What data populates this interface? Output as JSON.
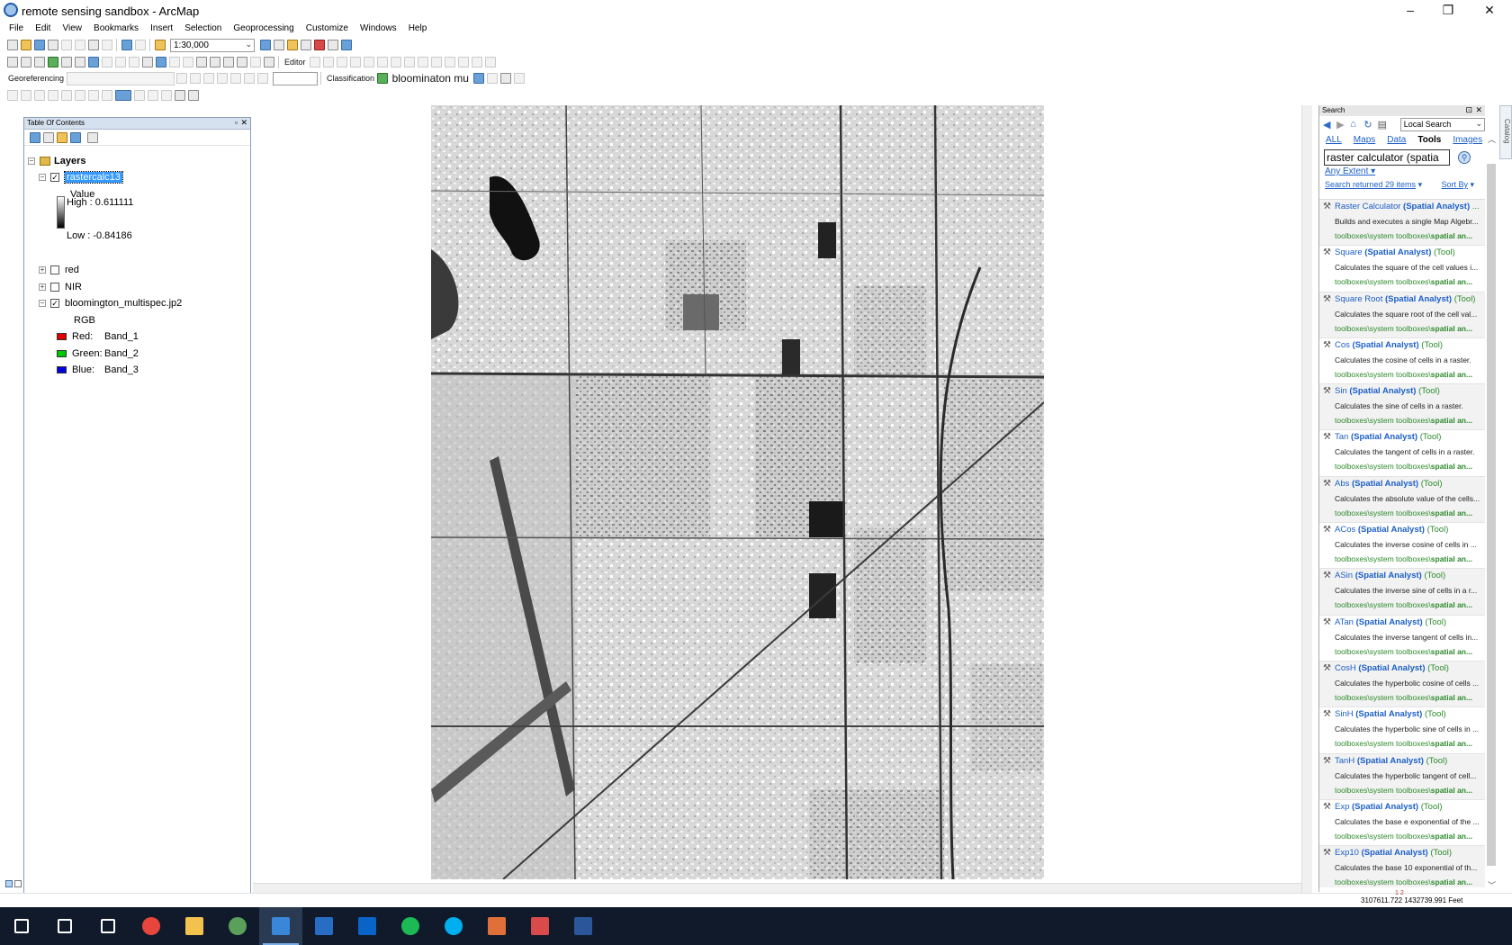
{
  "window": {
    "title": "remote sensing sandbox - ArcMap",
    "minimize_glyph": "–",
    "restore_glyph": "❐",
    "close_glyph": "✕"
  },
  "menu": [
    "File",
    "Edit",
    "View",
    "Bookmarks",
    "Insert",
    "Selection",
    "Geoprocessing",
    "Customize",
    "Windows",
    "Help"
  ],
  "toolbars": {
    "scale_value": "1:30,000",
    "editor_label": "Editor",
    "georeferencing_label": "Georeferencing",
    "classification_label": "Classification",
    "layer_combo_value": "bloominaton mu"
  },
  "toc": {
    "panel_title": "Table Of Contents",
    "root_label": "Layers",
    "layers": [
      {
        "name": "rastercalc13",
        "checked": true,
        "expanded": true,
        "selected": true
      },
      {
        "name": "red",
        "checked": false,
        "expanded": false
      },
      {
        "name": "NIR",
        "checked": false,
        "expanded": false
      },
      {
        "name": "bloomington_multispec.jp2",
        "checked": true,
        "expanded": true
      }
    ],
    "rastercalc_legend": {
      "field": "Value",
      "high": "High : 0.611111",
      "low": "Low : -0.84186"
    },
    "rgb_legend": {
      "title": "RGB",
      "bands": [
        {
          "channel": "Red:",
          "band": "Band_1",
          "color": "#e00000"
        },
        {
          "channel": "Green:",
          "band": "Band_2",
          "color": "#00c800"
        },
        {
          "channel": "Blue:",
          "band": "Band_3",
          "color": "#0000e0"
        }
      ]
    }
  },
  "search": {
    "panel_title": "Search",
    "scope": "Local Search",
    "categories": [
      "ALL",
      "Maps",
      "Data",
      "Tools",
      "Images"
    ],
    "active_category": "Tools",
    "query": "raster calculator (spatia",
    "extent": "Any Extent",
    "result_count": "Search returned 29 items",
    "sort_label": "Sort By",
    "results": [
      {
        "name": "Raster Calculator",
        "toolset": "(Spatial Analyst)",
        "type": "...",
        "desc": "Builds and executes a single Map Algebr...",
        "path": "toolboxes\\system toolboxes\\",
        "path_bold": "spatial an..."
      },
      {
        "name": "Square",
        "toolset": "(Spatial Analyst)",
        "type": "(Tool)",
        "desc": "Calculates the square of the cell values i...",
        "path": "toolboxes\\system toolboxes\\",
        "path_bold": "spatial an..."
      },
      {
        "name": "Square Root",
        "toolset": "(Spatial Analyst)",
        "type": "(Tool)",
        "desc": "Calculates the square root of the cell val...",
        "path": "toolboxes\\system toolboxes\\",
        "path_bold": "spatial an..."
      },
      {
        "name": "Cos",
        "toolset": "(Spatial Analyst)",
        "type": "(Tool)",
        "desc": "Calculates the cosine of cells in a raster.",
        "path": "toolboxes\\system toolboxes\\",
        "path_bold": "spatial an..."
      },
      {
        "name": "Sin",
        "toolset": "(Spatial Analyst)",
        "type": "(Tool)",
        "desc": "Calculates the sine of cells in a raster.",
        "path": "toolboxes\\system toolboxes\\",
        "path_bold": "spatial an..."
      },
      {
        "name": "Tan",
        "toolset": "(Spatial Analyst)",
        "type": "(Tool)",
        "desc": "Calculates the tangent of cells in a raster.",
        "path": "toolboxes\\system toolboxes\\",
        "path_bold": "spatial an..."
      },
      {
        "name": "Abs",
        "toolset": "(Spatial Analyst)",
        "type": "(Tool)",
        "desc": "Calculates the absolute value of the cells...",
        "path": "toolboxes\\system toolboxes\\",
        "path_bold": "spatial an..."
      },
      {
        "name": "ACos",
        "toolset": "(Spatial Analyst)",
        "type": "(Tool)",
        "desc": "Calculates the inverse cosine of cells in ...",
        "path": "toolboxes\\system toolboxes\\",
        "path_bold": "spatial an..."
      },
      {
        "name": "ASin",
        "toolset": "(Spatial Analyst)",
        "type": "(Tool)",
        "desc": "Calculates the inverse sine of cells in a r...",
        "path": "toolboxes\\system toolboxes\\",
        "path_bold": "spatial an..."
      },
      {
        "name": "ATan",
        "toolset": "(Spatial Analyst)",
        "type": "(Tool)",
        "desc": "Calculates the inverse tangent of cells in...",
        "path": "toolboxes\\system toolboxes\\",
        "path_bold": "spatial an..."
      },
      {
        "name": "CosH",
        "toolset": "(Spatial Analyst)",
        "type": "(Tool)",
        "desc": "Calculates the hyperbolic cosine of cells ...",
        "path": "toolboxes\\system toolboxes\\",
        "path_bold": "spatial an..."
      },
      {
        "name": "SinH",
        "toolset": "(Spatial Analyst)",
        "type": "(Tool)",
        "desc": "Calculates the hyperbolic sine of cells in ...",
        "path": "toolboxes\\system toolboxes\\",
        "path_bold": "spatial an..."
      },
      {
        "name": "TanH",
        "toolset": "(Spatial Analyst)",
        "type": "(Tool)",
        "desc": "Calculates the hyperbolic tangent of cell...",
        "path": "toolboxes\\system toolboxes\\",
        "path_bold": "spatial an..."
      },
      {
        "name": "Exp",
        "toolset": "(Spatial Analyst)",
        "type": "(Tool)",
        "desc": "Calculates the base e exponential of the ...",
        "path": "toolboxes\\system toolboxes\\",
        "path_bold": "spatial an..."
      },
      {
        "name": "Exp10",
        "toolset": "(Spatial Analyst)",
        "type": "(Tool)",
        "desc": "Calculates the base 10 exponential of th...",
        "path": "toolboxes\\system toolboxes\\",
        "path_bold": "spatial an..."
      }
    ],
    "pager": "1 2"
  },
  "status": {
    "coordinates": "3107611.722  1432739.991 Feet"
  },
  "taskbar": {
    "icons": [
      "windows-start-icon",
      "search-icon",
      "task-view-icon",
      "chrome-icon",
      "file-explorer-icon",
      "globe-app-icon",
      "arcmap-icon",
      "r-icon",
      "outlook-icon",
      "spotify-icon",
      "skype-icon",
      "matlab-icon",
      "paint-icon",
      "word-icon"
    ],
    "active": "arcmap-icon"
  },
  "colors": {
    "accent": "#1c5fc7",
    "path_green": "#2c8a2c",
    "selection": "#3399ff",
    "taskbar": "#101a2a"
  }
}
